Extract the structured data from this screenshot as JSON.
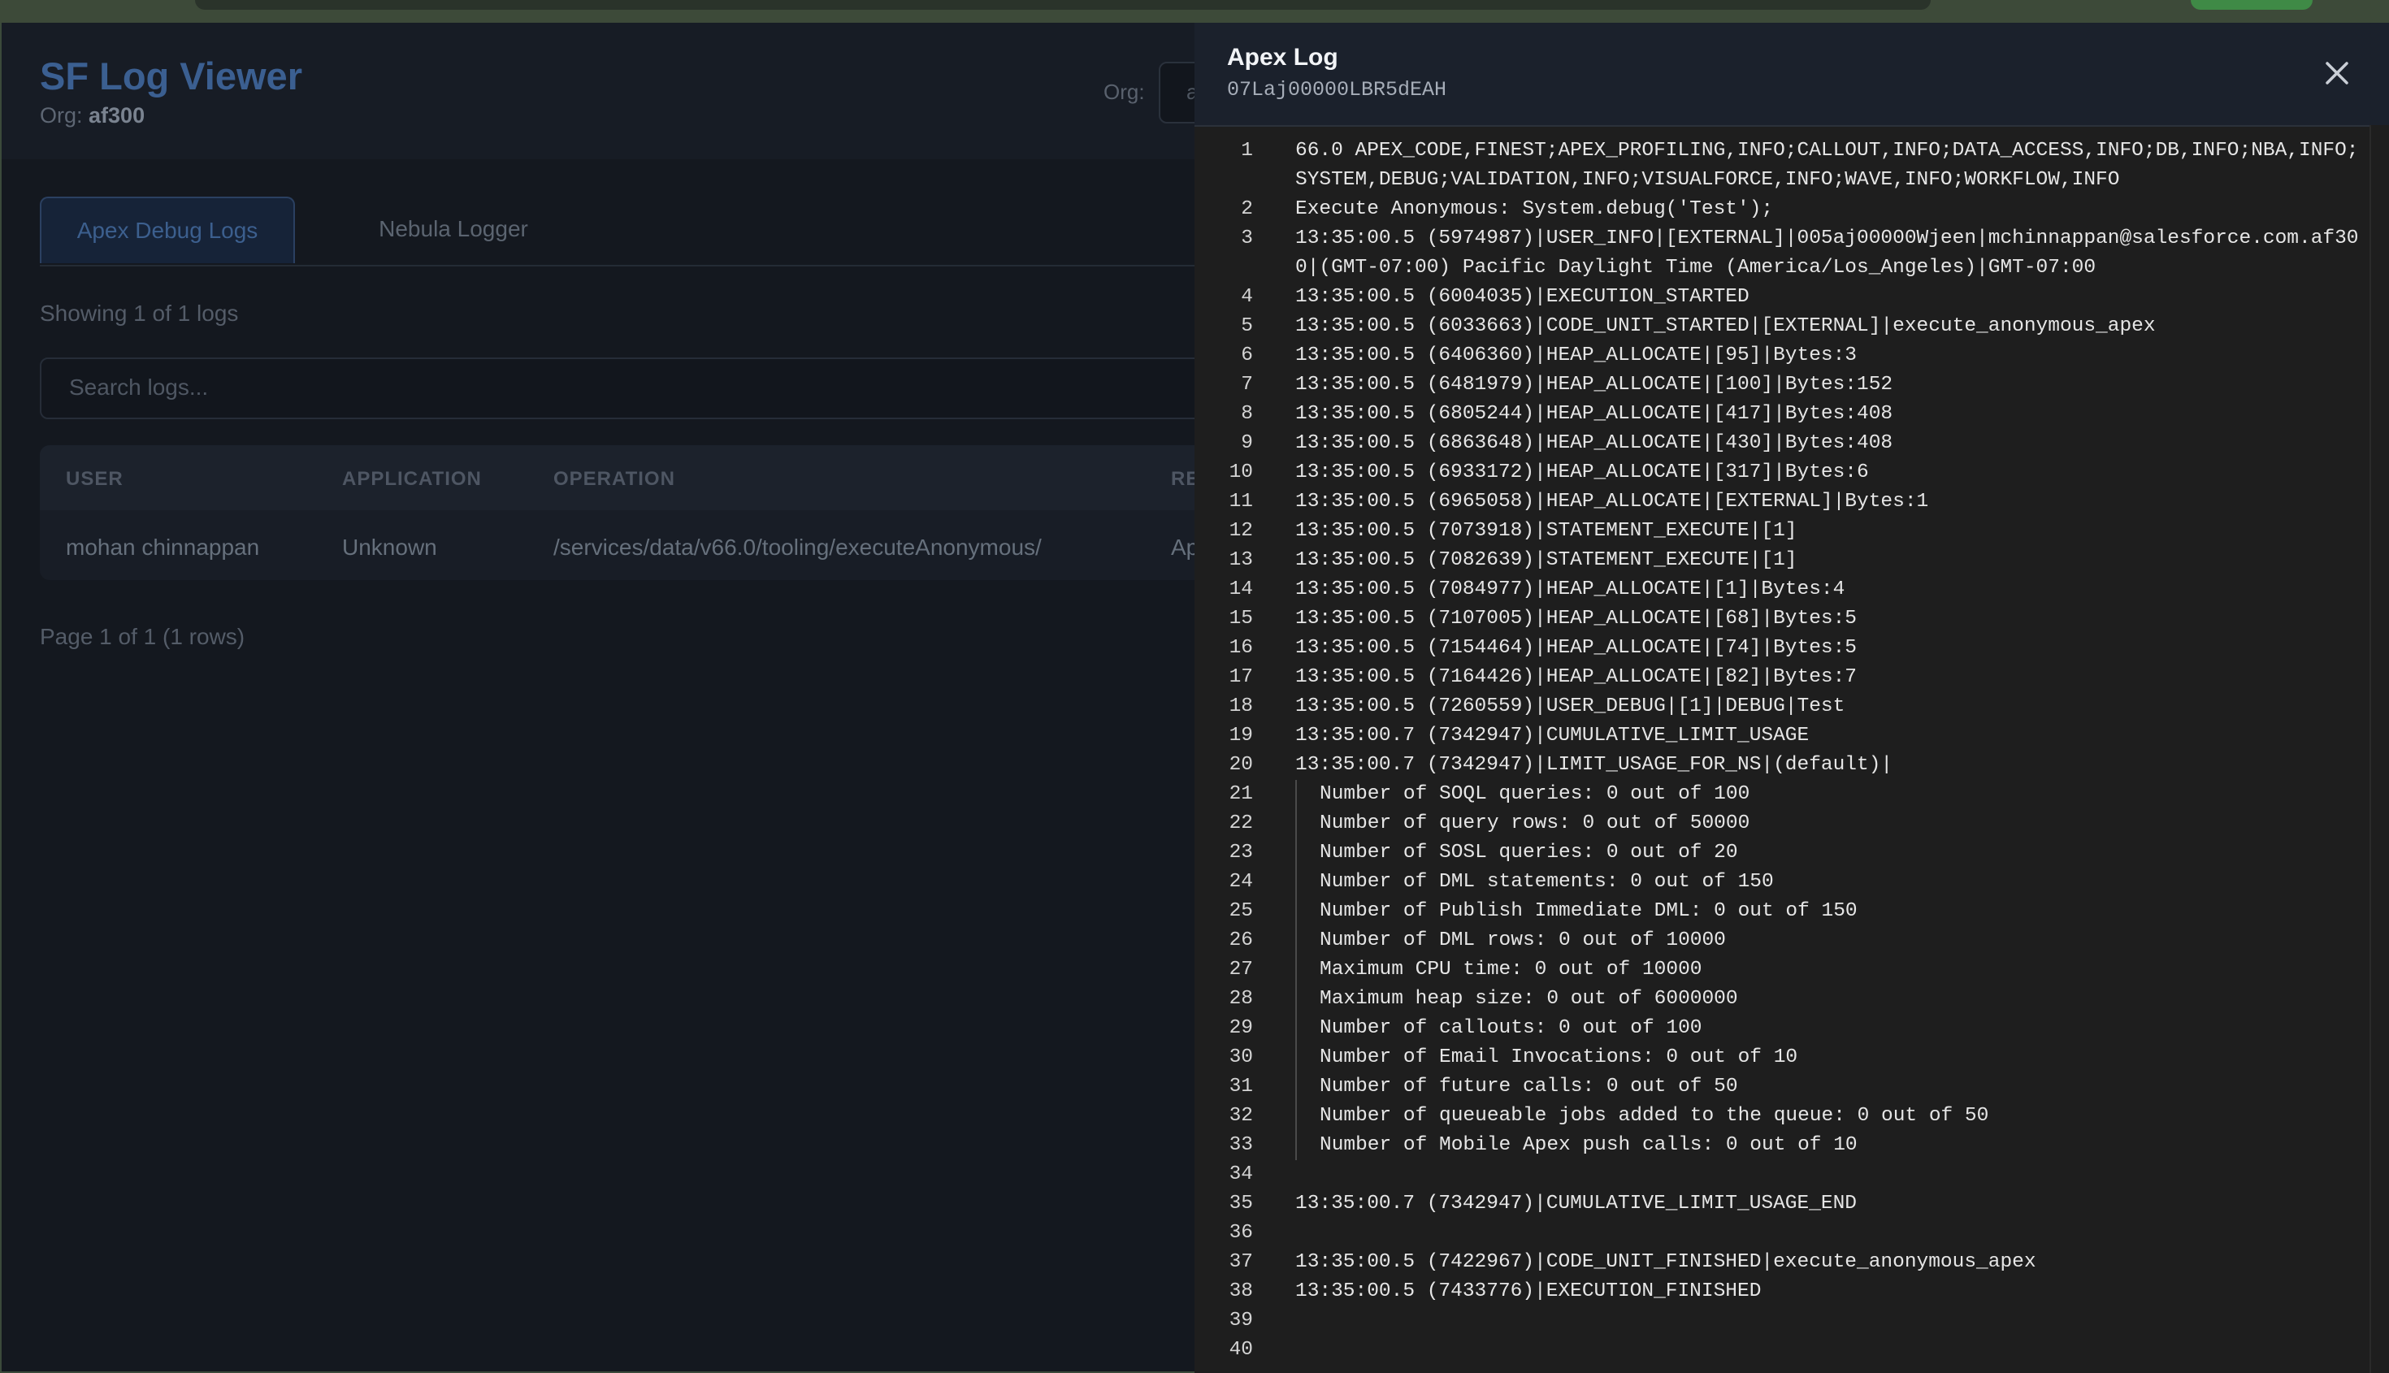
{
  "app": {
    "title": "SF Log Viewer",
    "org_prefix": "Org:",
    "org_name": "af300",
    "org_select_label": "Org:",
    "org_select_value": "a"
  },
  "tabs": [
    {
      "label": "Apex Debug Logs",
      "active": true
    },
    {
      "label": "Nebula Logger",
      "active": false
    }
  ],
  "showing_text": "Showing 1 of 1 logs",
  "search": {
    "placeholder": "Search logs...",
    "value": ""
  },
  "table": {
    "columns": [
      "USER",
      "APPLICATION",
      "OPERATION",
      "RE"
    ],
    "rows": [
      {
        "user": "mohan chinnappan",
        "application": "Unknown",
        "operation": "/services/data/v66.0/tooling/executeAnonymous/",
        "request": "Ap"
      }
    ]
  },
  "pager_text": "Page 1 of 1 (1 rows)",
  "drawer": {
    "title": "Apex Log",
    "log_id": "07Laj00000LBR5dEAH",
    "close_icon": "close-icon"
  },
  "log_lines": [
    "66.0 APEX_CODE,FINEST;APEX_PROFILING,INFO;CALLOUT,INFO;DATA_ACCESS,INFO;DB,INFO;NBA,INFO;SYSTEM,DEBUG;VALIDATION,INFO;VISUALFORCE,INFO;WAVE,INFO;WORKFLOW,INFO",
    "Execute Anonymous: System.debug('Test');",
    "13:35:00.5 (5974987)|USER_INFO|[EXTERNAL]|005aj00000Wjeen|mchinnappan@salesforce.com.af300|(GMT-07:00) Pacific Daylight Time (America/Los_Angeles)|GMT-07:00",
    "13:35:00.5 (6004035)|EXECUTION_STARTED",
    "13:35:00.5 (6033663)|CODE_UNIT_STARTED|[EXTERNAL]|execute_anonymous_apex",
    "13:35:00.5 (6406360)|HEAP_ALLOCATE|[95]|Bytes:3",
    "13:35:00.5 (6481979)|HEAP_ALLOCATE|[100]|Bytes:152",
    "13:35:00.5 (6805244)|HEAP_ALLOCATE|[417]|Bytes:408",
    "13:35:00.5 (6863648)|HEAP_ALLOCATE|[430]|Bytes:408",
    "13:35:00.5 (6933172)|HEAP_ALLOCATE|[317]|Bytes:6",
    "13:35:00.5 (6965058)|HEAP_ALLOCATE|[EXTERNAL]|Bytes:1",
    "13:35:00.5 (7073918)|STATEMENT_EXECUTE|[1]",
    "13:35:00.5 (7082639)|STATEMENT_EXECUTE|[1]",
    "13:35:00.5 (7084977)|HEAP_ALLOCATE|[1]|Bytes:4",
    "13:35:00.5 (7107005)|HEAP_ALLOCATE|[68]|Bytes:5",
    "13:35:00.5 (7154464)|HEAP_ALLOCATE|[74]|Bytes:5",
    "13:35:00.5 (7164426)|HEAP_ALLOCATE|[82]|Bytes:7",
    "13:35:00.5 (7260559)|USER_DEBUG|[1]|DEBUG|Test",
    "13:35:00.7 (7342947)|CUMULATIVE_LIMIT_USAGE",
    "13:35:00.7 (7342947)|LIMIT_USAGE_FOR_NS|(default)|",
    "Number of SOQL queries: 0 out of 100",
    "Number of query rows: 0 out of 50000",
    "Number of SOSL queries: 0 out of 20",
    "Number of DML statements: 0 out of 150",
    "Number of Publish Immediate DML: 0 out of 150",
    "Number of DML rows: 0 out of 10000",
    "Maximum CPU time: 0 out of 10000",
    "Maximum heap size: 0 out of 6000000",
    "Number of callouts: 0 out of 100",
    "Number of Email Invocations: 0 out of 10",
    "Number of future calls: 0 out of 50",
    "Number of queueable jobs added to the queue: 0 out of 50",
    "Number of Mobile Apex push calls: 0 out of 10",
    "",
    "13:35:00.7 (7342947)|CUMULATIVE_LIMIT_USAGE_END",
    "",
    "13:35:00.5 (7422967)|CODE_UNIT_FINISHED|execute_anonymous_apex",
    "13:35:00.5 (7433776)|EXECUTION_FINISHED",
    "",
    ""
  ]
}
